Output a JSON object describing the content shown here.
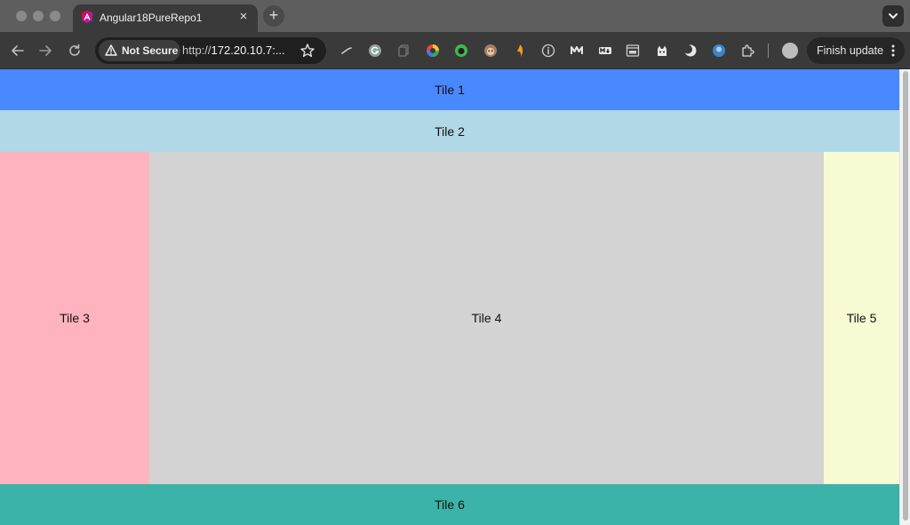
{
  "browser": {
    "tab": {
      "title": "Angular18PureRepo1",
      "close_glyph": "×"
    },
    "new_tab_glyph": "+",
    "address": {
      "security_label": "Not Secure",
      "url_prefix": "http://",
      "url_host": "172.20.10.7:..."
    },
    "finish_update_label": "Finish update"
  },
  "colors": {
    "tile1": "#4a88ff",
    "tile2": "#b0d8e6",
    "tile3": "#ffb3bf",
    "tile4": "#d3d3d3",
    "tile5": "#f8fad4",
    "tile6": "#3bb3a8"
  },
  "tiles": [
    {
      "label": "Tile 1"
    },
    {
      "label": "Tile 2"
    },
    {
      "label": "Tile 3"
    },
    {
      "label": "Tile 4"
    },
    {
      "label": "Tile 5"
    },
    {
      "label": "Tile 6"
    }
  ]
}
